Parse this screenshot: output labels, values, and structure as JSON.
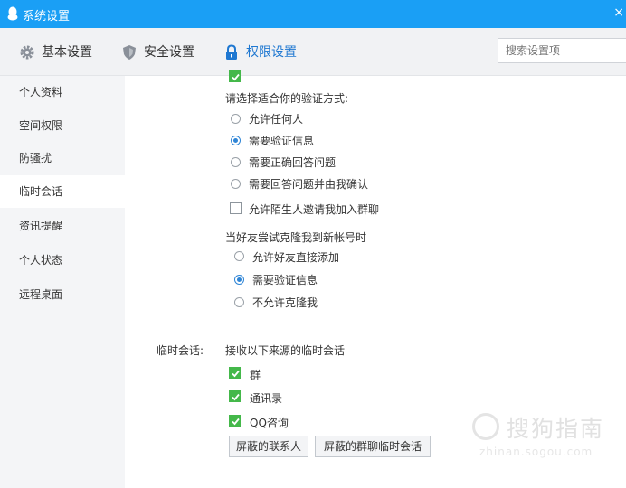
{
  "window": {
    "title": "系统设置",
    "close_glyph": "×"
  },
  "tabs": [
    {
      "label": "基本设置",
      "icon": "gear-icon"
    },
    {
      "label": "安全设置",
      "icon": "shield-icon"
    },
    {
      "label": "权限设置",
      "icon": "lock-icon",
      "active": true
    }
  ],
  "search": {
    "placeholder": "搜索设置项",
    "value": ""
  },
  "sidebar": {
    "items": [
      {
        "label": "个人资料"
      },
      {
        "label": "空间权限"
      },
      {
        "label": "防骚扰"
      },
      {
        "label": "临时会话",
        "active": true
      },
      {
        "label": "资讯提醒"
      },
      {
        "label": "个人状态"
      },
      {
        "label": "远程桌面"
      }
    ]
  },
  "verify": {
    "heading": "请选择适合你的验证方式:",
    "options": [
      {
        "label": "允许任何人",
        "selected": false
      },
      {
        "label": "需要验证信息",
        "selected": true
      },
      {
        "label": "需要正确回答问题",
        "selected": false
      },
      {
        "label": "需要回答问题并由我确认",
        "selected": false
      }
    ],
    "invite_checkbox": {
      "label": "允许陌生人邀请我加入群聊",
      "checked": false
    }
  },
  "clone": {
    "heading": "当好友尝试克隆我到新帐号时",
    "options": [
      {
        "label": "允许好友直接添加",
        "selected": false
      },
      {
        "label": "需要验证信息",
        "selected": true
      },
      {
        "label": "不允许克隆我",
        "selected": false
      }
    ]
  },
  "temp_session": {
    "section_label": "临时会话:",
    "heading": "接收以下来源的临时会话",
    "sources": [
      {
        "label": "群",
        "checked": true
      },
      {
        "label": "通讯录",
        "checked": true
      },
      {
        "label": "QQ咨询",
        "checked": true
      }
    ],
    "buttons": {
      "blocked_contacts": "屏蔽的联系人",
      "blocked_group_sessions": "屏蔽的群聊临时会话"
    }
  },
  "watermark": {
    "text": "搜狗指南",
    "sub": "zhinan.sogou.com"
  },
  "colors": {
    "titlebar": "#1a9ff5",
    "accent": "#1f78d1",
    "check_green": "#44b84a",
    "radio_blue": "#2f85d6"
  }
}
